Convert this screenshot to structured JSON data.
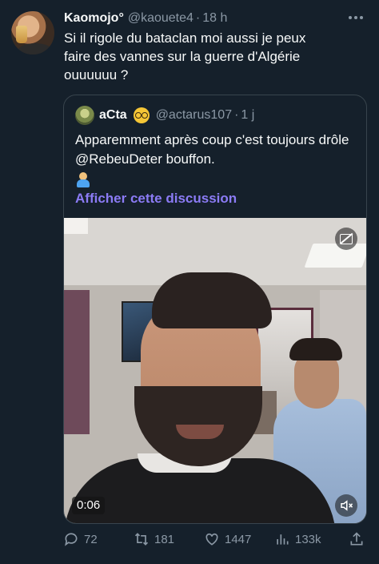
{
  "tweet": {
    "display_name": "Kaomojo°",
    "handle": "@kaouete4",
    "separator": "·",
    "time": "18 h",
    "text": "Si il rigole du bataclan moi aussi je peux\nfaire des vannes sur la guerre d'Algérie\nouuuuuu ?"
  },
  "quote": {
    "display_name": "aCta",
    "handle": "@actarus107",
    "separator": "·",
    "time": "1 j",
    "text": "Apparemment après coup c'est toujours drôle @RebeuDeter bouffon.",
    "show_thread": "Afficher cette discussion",
    "video": {
      "duration": "0:06"
    }
  },
  "actions": {
    "replies": "72",
    "retweets": "181",
    "likes": "1447",
    "views": "133k"
  },
  "colors": {
    "background": "#15202b",
    "link": "#8b7bf5",
    "muted": "#8b98a5"
  }
}
